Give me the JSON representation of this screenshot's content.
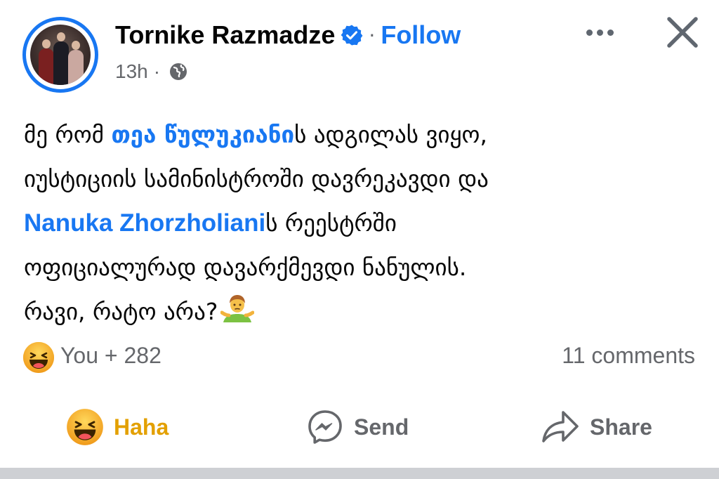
{
  "author": {
    "name": "Tornike Razmadze",
    "verified": true,
    "follow_label": "Follow",
    "separator": "·"
  },
  "meta": {
    "time": "13h",
    "separator": "·",
    "audience_icon": "globe-icon"
  },
  "header_actions": {
    "more_icon": "more-horizontal-icon",
    "close_icon": "close-icon"
  },
  "post": {
    "line1_prefix": "მე რომ ",
    "line1_mention": "თეა წულუკიანი",
    "line1_suffix": "ს ადგილას ვიყო,",
    "line2": "იუსტიციის სამინისტროში დავრეკავდი და",
    "line3_mention": "Nanuka Zhorzholiani",
    "line3_suffix": "ს რეესტრში",
    "line4": "ოფიციალურად დავარქმევდი ნანულის.",
    "line5": "რავი, რატო არა?",
    "line5_emoji": "person-shrugging-emoji"
  },
  "stats": {
    "reaction_icon": "haha-emoji",
    "reaction_count": "You + 282",
    "comments": "11 comments"
  },
  "actions": {
    "haha_label": "Haha",
    "send_label": "Send",
    "share_label": "Share"
  },
  "colors": {
    "accent": "#1877f2",
    "text_primary": "#050505",
    "text_secondary": "#65676b",
    "haha_label": "#e3a000",
    "divider": "#ced0d4"
  }
}
